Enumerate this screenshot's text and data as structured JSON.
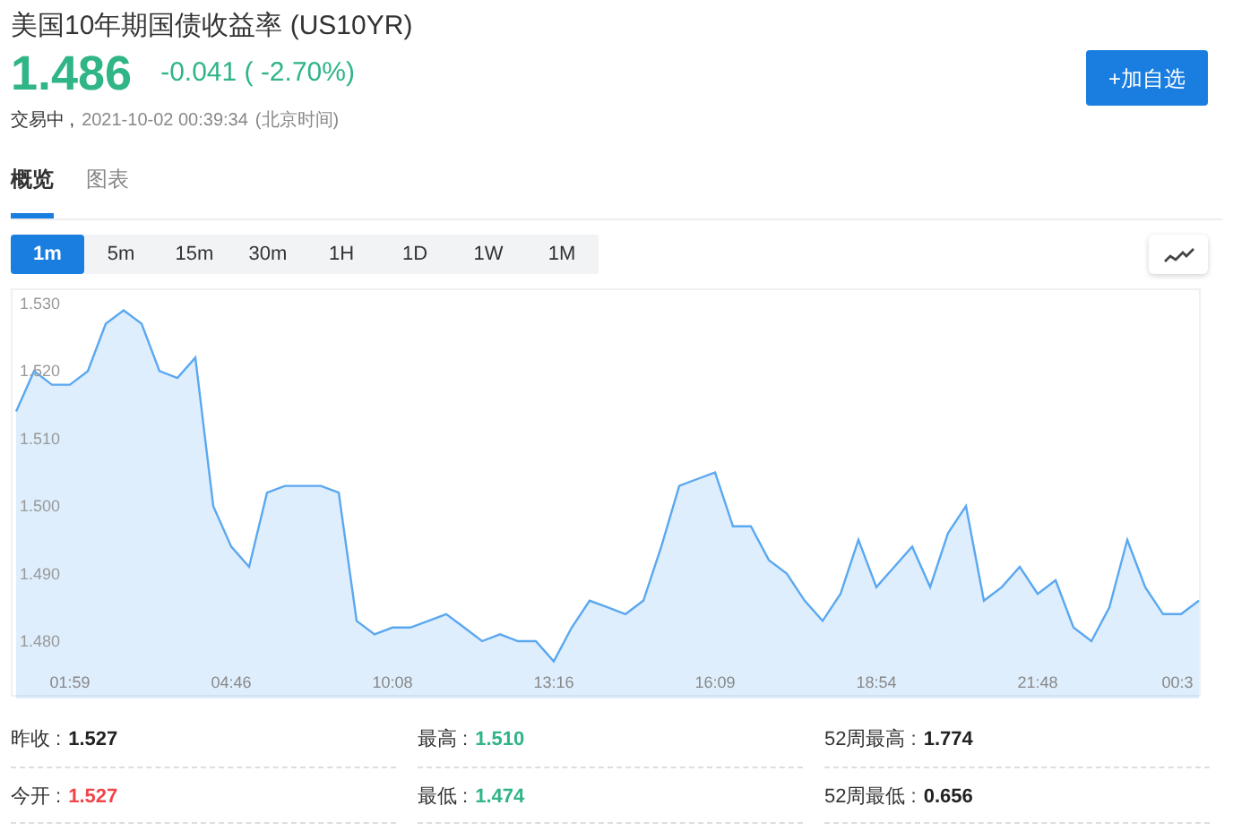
{
  "header": {
    "title": "美国10年期国债收益率 (US10YR)",
    "price": "1.486",
    "change": "-0.041 ( -2.70%)",
    "status": "交易中 ,",
    "time": "2021-10-02 00:39:34",
    "timezone": "(北京时间)",
    "watch_button": "+加自选"
  },
  "tabs": [
    {
      "label": "概览",
      "selected": true
    },
    {
      "label": "图表",
      "selected": false
    }
  ],
  "periods": [
    {
      "label": "1m",
      "selected": true
    },
    {
      "label": "5m",
      "selected": false
    },
    {
      "label": "15m",
      "selected": false
    },
    {
      "label": "30m",
      "selected": false
    },
    {
      "label": "1H",
      "selected": false
    },
    {
      "label": "1D",
      "selected": false
    },
    {
      "label": "1W",
      "selected": false
    },
    {
      "label": "1M",
      "selected": false
    }
  ],
  "chart": {
    "chart_data": {
      "type": "area",
      "categories": [
        null,
        null,
        null,
        "01:59",
        null,
        null,
        null,
        null,
        null,
        null,
        null,
        null,
        "04:46",
        null,
        null,
        null,
        null,
        null,
        null,
        null,
        null,
        "10:08",
        null,
        null,
        null,
        null,
        null,
        null,
        null,
        null,
        "13:16",
        null,
        null,
        null,
        null,
        null,
        null,
        null,
        null,
        "16:09",
        null,
        null,
        null,
        null,
        null,
        null,
        null,
        null,
        "18:54",
        null,
        null,
        null,
        null,
        null,
        null,
        null,
        null,
        "21:48",
        null,
        null,
        null,
        null,
        null,
        null,
        null,
        "00:3",
        null
      ],
      "ylim": [
        1.4715,
        1.532
      ],
      "yticks": [
        {
          "value": 1.53,
          "label": "1.530"
        },
        {
          "value": 1.52,
          "label": "1.520"
        },
        {
          "value": 1.51,
          "label": "1.510"
        },
        {
          "value": 1.5,
          "label": "1.500"
        },
        {
          "value": 1.49,
          "label": "1.490"
        },
        {
          "value": 1.48,
          "label": "1.480"
        }
      ],
      "series": [
        {
          "color": "#5aa8f0",
          "values": [
            1.514,
            1.52,
            1.518,
            1.518,
            1.52,
            1.527,
            1.529,
            1.527,
            1.52,
            1.519,
            1.522,
            1.5,
            1.494,
            1.491,
            1.502,
            1.503,
            1.503,
            1.503,
            1.502,
            1.483,
            1.481,
            1.482,
            1.482,
            1.483,
            1.484,
            1.482,
            1.48,
            1.481,
            1.48,
            1.48,
            1.477,
            1.482,
            1.486,
            1.485,
            1.484,
            1.486,
            1.494,
            1.503,
            1.504,
            1.505,
            1.497,
            1.497,
            1.492,
            1.49,
            1.486,
            1.483,
            1.487,
            1.495,
            1.488,
            1.491,
            1.494,
            1.488,
            1.496,
            1.5,
            1.486,
            1.488,
            1.491,
            1.487,
            1.489,
            1.482,
            1.48,
            1.485,
            1.495,
            1.488,
            1.484,
            1.484,
            1.486
          ]
        }
      ]
    }
  },
  "stats": [
    {
      "label": "昨收 :",
      "value": "1.527",
      "color": "#222222"
    },
    {
      "label": "最高 :",
      "value": "1.510",
      "color": "#2fb586"
    },
    {
      "label": "52周最高 :",
      "value": "1.774",
      "color": "#222222"
    },
    {
      "label": "今开 :",
      "value": "1.527",
      "color": "#f0464a"
    },
    {
      "label": "最低 :",
      "value": "1.474",
      "color": "#2fb586"
    },
    {
      "label": "52周最低 :",
      "value": "0.656",
      "color": "#222222"
    }
  ]
}
